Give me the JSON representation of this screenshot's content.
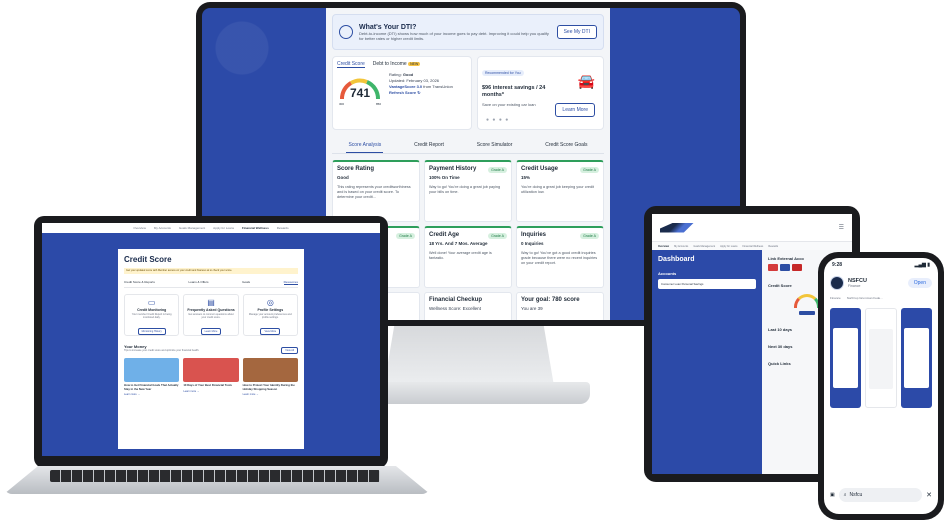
{
  "desktop": {
    "dti": {
      "title": "What's Your DTI?",
      "description": "Debt-to-income (DTI) shows how much of your income goes to pay debt. Improving it could help you qualify for better rates or higher credit limits.",
      "button": "See My DTI"
    },
    "score_card": {
      "tab_credit_score": "Credit Score",
      "tab_dti": "Debt to Income",
      "new_badge": "NEW",
      "score": "741",
      "gauge_min": "300",
      "gauge_max": "850",
      "rating_label": "Rating:",
      "rating": "Good",
      "updated": "Updated: February 03, 2026",
      "source_link": "VantageScore 3.0",
      "source_suffix": "from TransUnion",
      "refresh": "Refresh Score"
    },
    "recommendation": {
      "pill": "Recommended for You",
      "title": "$96 interest savings / 24 months*",
      "subtitle": "Save on your existing car loan",
      "button": "Learn More"
    },
    "tabs": [
      "Score Analysis",
      "Credit Report",
      "Score Simulator",
      "Credit Score Goals"
    ],
    "factors": [
      {
        "title": "Score Rating",
        "grade": "",
        "value": "Good",
        "desc": "This rating represents your creditworthiness and is based on your credit score. To determine your credit..."
      },
      {
        "title": "Payment History",
        "grade": "Grade A",
        "value": "100% On Time",
        "desc": "Way to go! You're doing a great job paying your bills on time."
      },
      {
        "title": "Credit Usage",
        "grade": "Grade A",
        "value": "15%",
        "desc": "You're doing a great job keeping your credit utilization low."
      },
      {
        "title": "",
        "grade": "Grade A",
        "value": "",
        "desc": ""
      },
      {
        "title": "Credit Age",
        "grade": "Grade A",
        "value": "18 Yrs. And 7 Mos. Average",
        "desc": "Well done! Your average credit age is fantastic."
      },
      {
        "title": "Inquiries",
        "grade": "Grade A",
        "value": "0 Inquiries",
        "desc": "Way to go! You've got a good credit inquiries grade because there were no recent inquiries on your credit report."
      }
    ],
    "bottom": [
      {
        "title": "",
        "sub": ""
      },
      {
        "title": "Financial Checkup",
        "sub": "Wellness Score: Excellent"
      },
      {
        "title": "Your goal: 780 score",
        "sub": "You are 39"
      }
    ]
  },
  "laptop": {
    "nav": [
      "Overview",
      "My Accounts",
      "Goals Management",
      "Apply for Loans",
      "Financial Wellness",
      "Rewards"
    ],
    "active_nav": "Financial Wellness",
    "title": "Credit Score",
    "alert": "Get your updated score with Member access on your credit and finances at to check your score.",
    "tabs": [
      "Credit Score & Reports",
      "Loans & Offers",
      "Goals",
      "Resources"
    ],
    "cards": [
      {
        "title": "Credit Monitoring",
        "desc": "Your member Credit Report is being monitored daily.",
        "button": "Monitoring History"
      },
      {
        "title": "Frequently Asked Questions",
        "desc": "Get answers to common questions about your credit score.",
        "button": "Learn More"
      },
      {
        "title": "Profile Settings",
        "desc": "Manage your account preferences and profile settings.",
        "button": "View More"
      }
    ],
    "money_title": "Your Money",
    "money_sub": "Tips to increase your credit score and optimize your financial health.",
    "money_button": "View All",
    "articles": [
      {
        "title": "How to Get Financial Goals That Actually Stay in the New Year",
        "link": "Learn more →",
        "color": "#6fb0e8"
      },
      {
        "title": "10 Days of Your Best Financial Tools",
        "link": "Learn more →",
        "color": "#d9534f"
      },
      {
        "title": "How to Protect Your Identity During the Holiday Shopping Season",
        "link": "Learn more →",
        "color": "#a4673f"
      }
    ]
  },
  "tablet": {
    "nav": [
      "Overview",
      "My Accounts",
      "Goals Management",
      "Apply for Loans",
      "Financial Wellness",
      "Rewards"
    ],
    "dashboard": "Dashboard",
    "accounts": "Accounts",
    "account_name": "Consumer Loan Personal Savings",
    "link_accounts": "Link External Acco",
    "credit_score": "Credit Score",
    "last_days": "Last 10 days",
    "next_days": "Next 30 days",
    "quick_links": "Quick Links"
  },
  "phone": {
    "time": "9:28",
    "app_name": "NSFCU",
    "app_type": "Finance",
    "open_button": "Open",
    "meta": [
      "Finance",
      "Northrop Grumman Fede..."
    ],
    "search_text": "Nsfcu"
  }
}
